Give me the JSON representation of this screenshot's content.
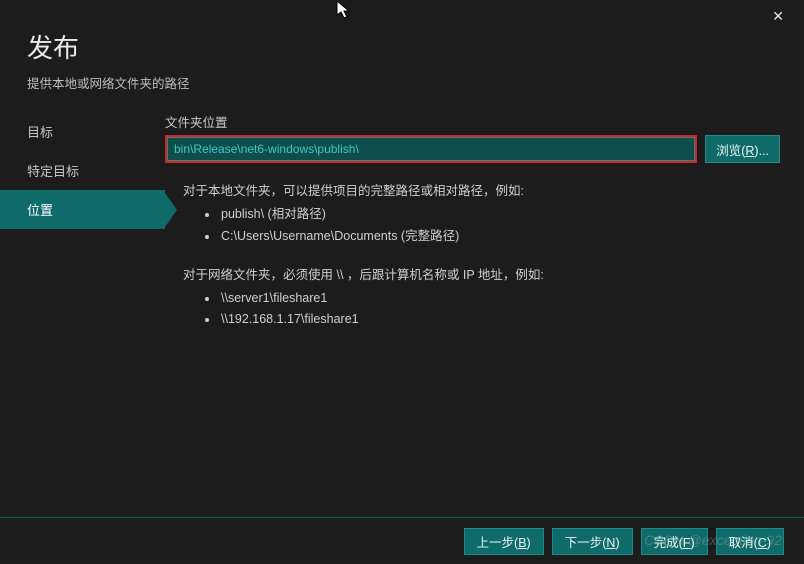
{
  "header": {
    "title": "发布",
    "subtitle": "提供本地或网络文件夹的路径"
  },
  "sidebar": {
    "items": [
      {
        "label": "目标",
        "active": false
      },
      {
        "label": "特定目标",
        "active": false
      },
      {
        "label": "位置",
        "active": true
      }
    ]
  },
  "content": {
    "field_label": "文件夹位置",
    "path_value": "bin\\Release\\net6-windows\\publish\\",
    "browse_label_prefix": "浏览",
    "browse_hotkey": "R",
    "help_local": {
      "intro": "对于本地文件夹，可以提供项目的完整路径或相对路径，例如:",
      "ex1": "publish\\ (相对路径)",
      "ex2": "C:\\Users\\Username\\Documents (完整路径)"
    },
    "help_network": {
      "intro": "对于网络文件夹，必须使用 \\\\ ，后跟计算机名称或 IP 地址，例如:",
      "ex1": "\\\\server1\\fileshare1",
      "ex2": "\\\\192.168.1.17\\fileshare1"
    }
  },
  "footer": {
    "back_prefix": "上一步",
    "back_hotkey": "B",
    "next_prefix": "下一步",
    "next_hotkey": "N",
    "finish_prefix": "完成",
    "finish_hotkey": "F",
    "cancel_prefix": "取消",
    "cancel_hotkey": "C"
  },
  "watermark": "CSDN @exception-92",
  "colors": {
    "accent": "#0f6b6a",
    "highlight_border": "#e02020",
    "input_bg": "#0f4c4c",
    "input_text": "#3ec9c4",
    "bg": "#1c1c1c"
  }
}
